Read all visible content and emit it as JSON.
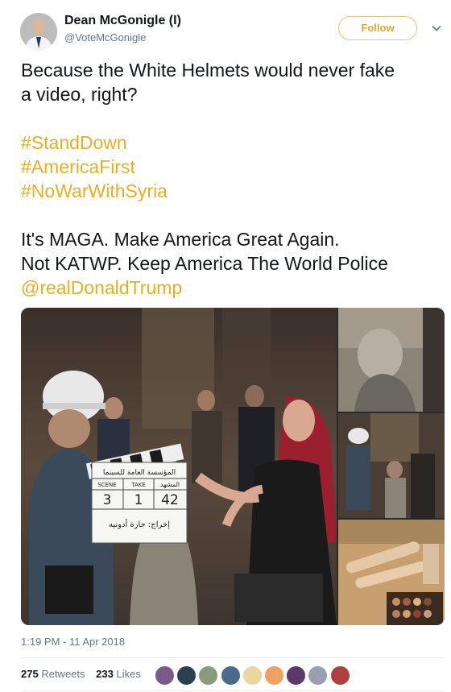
{
  "user": {
    "display_name": "Dean McGonigle (I)",
    "handle": "@VoteMcGonigle",
    "follow_label": "Follow"
  },
  "tweet": {
    "line1": "Because the White Helmets would never fake",
    "line2": "a video, right?",
    "hashtags": [
      "#StandDown",
      "#AmericaFirst",
      "#NoWarWithSyria"
    ],
    "line3": "It's MAGA. Make America Great Again.",
    "line4": "Not KATWP. Keep America The World Police",
    "mention": "@realDonaldTrump"
  },
  "media": {
    "clapper": {
      "row1": "المؤسسة العامة للسينما",
      "row2_col1": "SCENE",
      "row2_col2": "TAKE",
      "row2_col3": "المشهد",
      "values": [
        "3",
        "1",
        "42"
      ],
      "footer": "إخراج: جارة أدونيه"
    }
  },
  "timestamp": "1:19 PM - 11 Apr 2018",
  "stats": {
    "retweets_count": "275",
    "retweets_label": "Retweets",
    "likes_count": "233",
    "likes_label": "Likes"
  },
  "colors": {
    "accent": "#e8b020",
    "follow_border": "#e8c57a",
    "meta_gray": "#657786"
  },
  "liker_colors": [
    "#7a5a8a",
    "#2c3e50",
    "#8a9a7a",
    "#4a6a8a",
    "#e8d8a0",
    "#f0a060",
    "#5a3a6a",
    "#9aa0b0",
    "#b04040"
  ]
}
